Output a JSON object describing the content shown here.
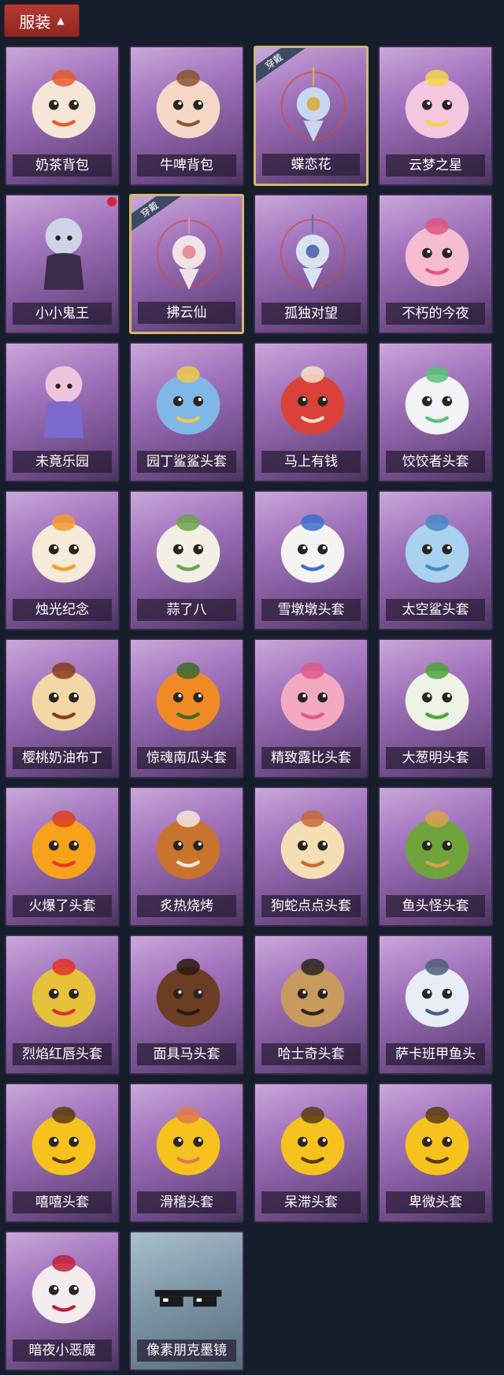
{
  "header": {
    "label": "服装"
  },
  "equipped_badge": "穿戴",
  "items": [
    {
      "name": "奶茶背包",
      "icon": "milk-tea-backpack-icon",
      "color": "#f5e6d8",
      "accent": "#e85a2a",
      "equipped": false,
      "new": false
    },
    {
      "name": "牛啤背包",
      "icon": "cow-beer-backpack-icon",
      "color": "#f7d8c8",
      "accent": "#8a5530",
      "equipped": false,
      "new": false
    },
    {
      "name": "蝶恋花",
      "icon": "butterfly-flower-charm-icon",
      "color": "#c9d7ef",
      "accent": "#d9b04a",
      "equipped": true,
      "new": false
    },
    {
      "name": "云梦之星",
      "icon": "cloud-unicorn-star-icon",
      "color": "#f4c6e0",
      "accent": "#f3d54c",
      "equipped": false,
      "new": false
    },
    {
      "name": "小小鬼王",
      "icon": "little-ghost-king-figure-icon",
      "color": "#cfd3e6",
      "accent": "#3a2c4a",
      "equipped": false,
      "new": true
    },
    {
      "name": "拂云仙",
      "icon": "cloud-fairy-charm-icon",
      "color": "#f0e3e6",
      "accent": "#e58fa1",
      "equipped": true,
      "new": false
    },
    {
      "name": "孤独对望",
      "icon": "lonely-gaze-charm-icon",
      "color": "#d8e3f2",
      "accent": "#5c6fb0",
      "equipped": false,
      "new": false
    },
    {
      "name": "不朽的今夜",
      "icon": "pink-fox-bowl-icon",
      "color": "#f5bcd2",
      "accent": "#e1557f",
      "equipped": false,
      "new": false
    },
    {
      "name": "未竟乐园",
      "icon": "paradise-girl-figure-icon",
      "color": "#f0c3dc",
      "accent": "#7c6ad1",
      "equipped": false,
      "new": false
    },
    {
      "name": "园丁鲨鲨头套",
      "icon": "gardener-shark-head-icon",
      "color": "#7fb8e6",
      "accent": "#f0c84a",
      "equipped": false,
      "new": false
    },
    {
      "name": "马上有钱",
      "icon": "red-horse-head-icon",
      "color": "#d9413a",
      "accent": "#f4e3c9",
      "equipped": false,
      "new": false
    },
    {
      "name": "饺饺者头套",
      "icon": "dumpling-head-icon",
      "color": "#f2f4f8",
      "accent": "#5cc07a",
      "equipped": false,
      "new": false
    },
    {
      "name": "烛光纪念",
      "icon": "candle-head-icon",
      "color": "#f6ead8",
      "accent": "#f49a2a",
      "equipped": false,
      "new": false
    },
    {
      "name": "蒜了八",
      "icon": "garlic-head-icon",
      "color": "#f3efe4",
      "accent": "#6aa54a",
      "equipped": false,
      "new": false
    },
    {
      "name": "雪墩墩头套",
      "icon": "snowman-head-icon",
      "color": "#f6f4f2",
      "accent": "#3a6fd0",
      "equipped": false,
      "new": false
    },
    {
      "name": "太空鲨头套",
      "icon": "space-shark-head-icon",
      "color": "#a9d2ef",
      "accent": "#4a86c5",
      "equipped": false,
      "new": false
    },
    {
      "name": "樱桃奶油布丁",
      "icon": "cherry-pudding-head-icon",
      "color": "#f4d7a6",
      "accent": "#8a3a1e",
      "equipped": false,
      "new": false
    },
    {
      "name": "惊魂南瓜头套",
      "icon": "pumpkin-head-icon",
      "color": "#f08a24",
      "accent": "#3e6b2a",
      "equipped": false,
      "new": false
    },
    {
      "name": "精致露比头套",
      "icon": "loopy-head-icon",
      "color": "#f3a9bf",
      "accent": "#e05a8a",
      "equipped": false,
      "new": false
    },
    {
      "name": "大葱明头套",
      "icon": "green-onion-head-icon",
      "color": "#eef3e6",
      "accent": "#4aa53a",
      "equipped": false,
      "new": false
    },
    {
      "name": "火爆了头套",
      "icon": "fireball-head-icon",
      "color": "#f7a21b",
      "accent": "#e0401f",
      "equipped": false,
      "new": false
    },
    {
      "name": "炙热烧烤",
      "icon": "grilled-meat-head-icon",
      "color": "#c8742f",
      "accent": "#f3e9dd",
      "equipped": false,
      "new": false
    },
    {
      "name": "狗蛇点点头套",
      "icon": "snake-dog-head-icon",
      "color": "#f4dfb5",
      "accent": "#c96a3a",
      "equipped": false,
      "new": false
    },
    {
      "name": "鱼头怪头套",
      "icon": "fish-monster-head-icon",
      "color": "#6fa33c",
      "accent": "#d9a24a",
      "equipped": false,
      "new": false
    },
    {
      "name": "烈焰红唇头套",
      "icon": "red-lips-head-icon",
      "color": "#e6c23a",
      "accent": "#e0332a",
      "equipped": false,
      "new": false
    },
    {
      "name": "面具马头套",
      "icon": "horse-mask-head-icon",
      "color": "#6b3e24",
      "accent": "#2a1a12",
      "equipped": false,
      "new": false
    },
    {
      "name": "哈士奇头套",
      "icon": "husky-head-icon",
      "color": "#c99a5e",
      "accent": "#2a2420",
      "equipped": false,
      "new": false
    },
    {
      "name": "萨卡班甲鱼头",
      "icon": "sacabambaspis-head-icon",
      "color": "#e8eef5",
      "accent": "#4d5f7a",
      "equipped": false,
      "new": false
    },
    {
      "name": "嘻嘻头套",
      "icon": "grinning-emoji-head-icon",
      "color": "#f6c21e",
      "accent": "#5a3a10",
      "equipped": false,
      "new": false
    },
    {
      "name": "滑稽头套",
      "icon": "funny-emoji-head-icon",
      "color": "#f6c21e",
      "accent": "#e07a4a",
      "equipped": false,
      "new": false
    },
    {
      "name": "呆滞头套",
      "icon": "dazed-emoji-head-icon",
      "color": "#f6c21e",
      "accent": "#5a3a10",
      "equipped": false,
      "new": false
    },
    {
      "name": "卑微头套",
      "icon": "humble-emoji-head-icon",
      "color": "#f6c21e",
      "accent": "#5a3a10",
      "equipped": false,
      "new": false
    },
    {
      "name": "暗夜小恶魔",
      "icon": "little-devil-head-icon",
      "color": "#f5ecef",
      "accent": "#c0203a",
      "equipped": false,
      "new": false
    },
    {
      "name": "像素朋克墨镜",
      "icon": "pixel-sunglasses-icon",
      "color": "#1a1a1a",
      "accent": "#ffffff",
      "equipped": false,
      "new": false
    }
  ]
}
